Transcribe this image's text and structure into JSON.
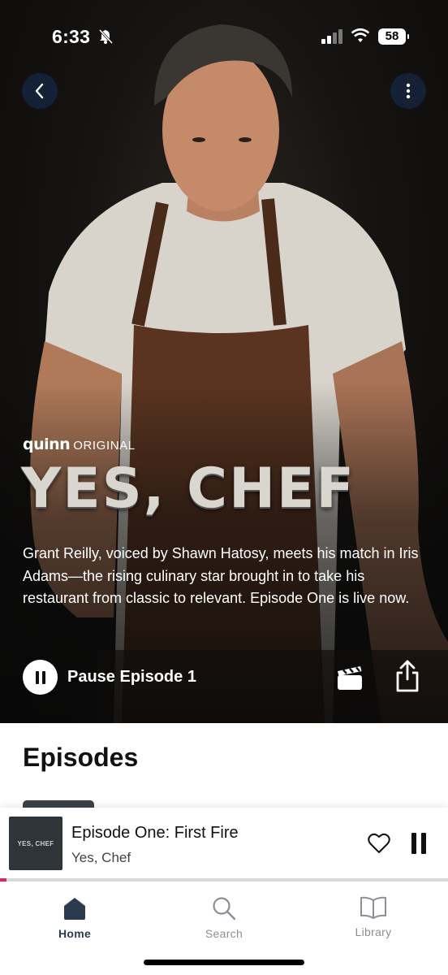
{
  "status_bar": {
    "time": "6:33",
    "battery": "58"
  },
  "hero": {
    "brand": {
      "logo": "quinn",
      "label": "ORIGINAL"
    },
    "title": "YES, CHEF",
    "description": "Grant Reilly, voiced by Shawn Hatosy, meets his match in Iris Adams—the rising culinary star brought in to take his restaurant from classic to relevant. Episode One is live now.",
    "pause_label": "Pause Episode 1"
  },
  "episodes": {
    "heading": "Episodes"
  },
  "mini_player": {
    "art_text": "YES, CHEF",
    "title": "Episode One: First Fire",
    "subtitle": "Yes, Chef",
    "progress": 0.015
  },
  "tabs": [
    {
      "label": "Home",
      "icon": "home-icon",
      "active": true
    },
    {
      "label": "Search",
      "icon": "search-icon",
      "active": false
    },
    {
      "label": "Library",
      "icon": "library-icon",
      "active": false
    }
  ],
  "colors": {
    "accent": "#e0245e",
    "active_tab": "#2c3a4e",
    "inactive_tab": "#8a8f96"
  }
}
